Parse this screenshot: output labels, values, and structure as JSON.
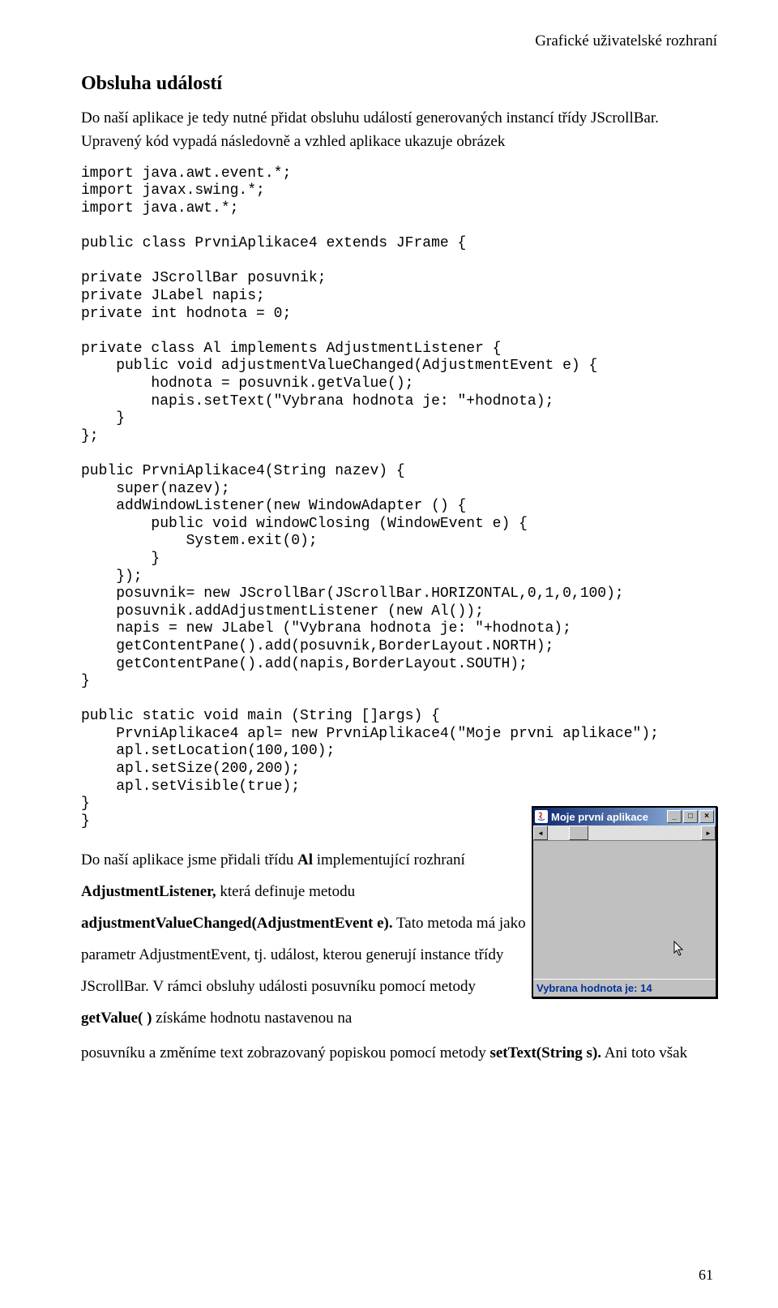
{
  "header": "Grafické uživatelské rozhraní",
  "sectionTitle": "Obsluha událostí",
  "intro": "Do naší aplikace je tedy nutné přidat obsluhu událostí generovaných instancí třídy JScrollBar. Upravený kód vypadá následovně a vzhled aplikace ukazuje obrázek",
  "code": "import java.awt.event.*;\nimport javax.swing.*;\nimport java.awt.*;\n\npublic class PrvniAplikace4 extends JFrame {\n\nprivate JScrollBar posuvnik;\nprivate JLabel napis;\nprivate int hodnota = 0;\n\nprivate class Al implements AdjustmentListener {\n    public void adjustmentValueChanged(AdjustmentEvent e) {\n        hodnota = posuvnik.getValue();\n        napis.setText(\"Vybrana hodnota je: \"+hodnota);\n    }\n};\n\npublic PrvniAplikace4(String nazev) {\n    super(nazev);\n    addWindowListener(new WindowAdapter () {\n        public void windowClosing (WindowEvent e) {\n            System.exit(0);\n        }\n    });\n    posuvnik= new JScrollBar(JScrollBar.HORIZONTAL,0,1,0,100);\n    posuvnik.addAdjustmentListener (new Al());\n    napis = new JLabel (\"Vybrana hodnota je: \"+hodnota);\n    getContentPane().add(posuvnik,BorderLayout.NORTH);\n    getContentPane().add(napis,BorderLayout.SOUTH);\n}\n\npublic static void main (String []args) {\n    PrvniAplikace4 apl= new PrvniAplikace4(\"Moje prvni aplikace\");\n    apl.setLocation(100,100);\n    apl.setSize(200,200);\n    apl.setVisible(true);\n}\n}",
  "descPart1": "Do naší aplikace jsme přidali třídu ",
  "descBold1": "Al",
  "descPart2": " implementující rozhraní ",
  "descBold2": "AdjustmentListener,",
  "descPart3": " která definuje metodu ",
  "descBold3": "adjustmentValueChanged(AdjustmentEvent e).",
  "descPart4": " Tato metoda má jako parametr AdjustmentEvent, tj. událost, kterou generují instance třídy JScrollBar. V rámci obsluhy události posuvníku pomocí metody ",
  "descBold4": "getValue( )",
  "descPart5": " získáme hodnotu nastavenou na",
  "finalLine": "posuvníku a změníme text zobrazovaný popiskou pomocí metody ",
  "finalBold": "setText(String s).",
  "finalTail": " Ani toto však",
  "pageNumber": "61",
  "app": {
    "title": "Moje první aplikace",
    "status": "Vybrana hodnota je: 14",
    "minimizeGlyph": "_",
    "maximizeGlyph": "□",
    "closeGlyph": "×",
    "arrowLeft": "◄",
    "arrowRight": "►"
  }
}
